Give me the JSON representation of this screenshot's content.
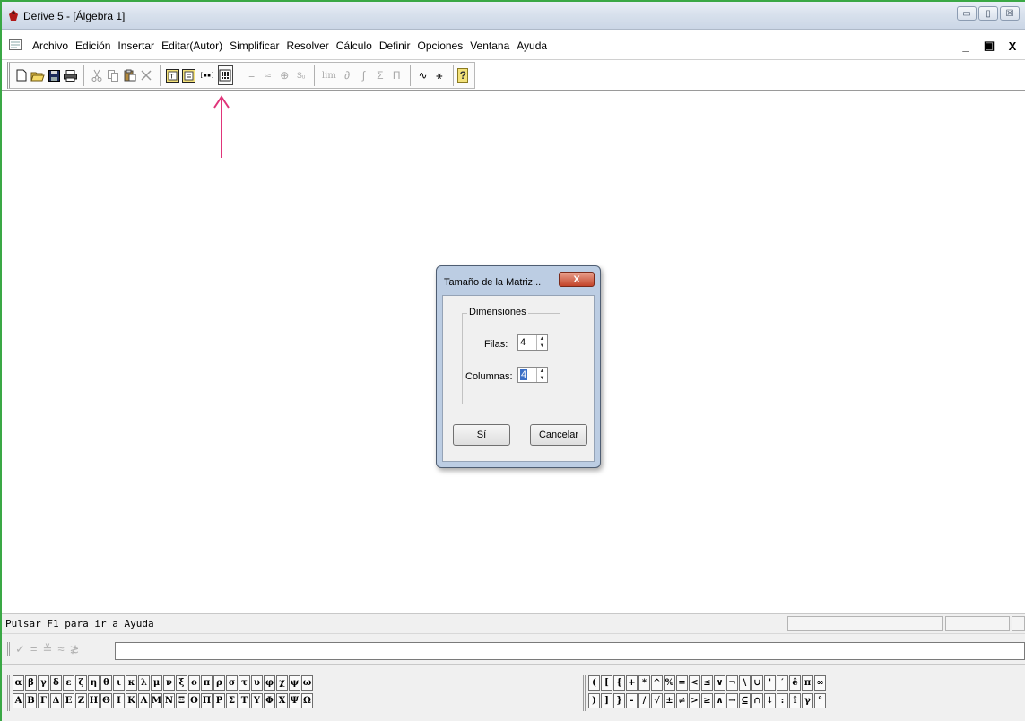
{
  "window": {
    "title": "Derive 5 - [Álgebra 1]",
    "sys_buttons": [
      "▭",
      "▯",
      "☒"
    ]
  },
  "menubar": {
    "items": [
      "Archivo",
      "Edición",
      "Insertar",
      "Editar(Autor)",
      "Simplificar",
      "Resolver",
      "Cálculo",
      "Definir",
      "Opciones",
      "Ventana",
      "Ayuda"
    ],
    "mdi_buttons": [
      "_",
      "▣",
      "X"
    ]
  },
  "toolbar": {
    "groups": [
      [
        "new-icon",
        "open-icon",
        "save-icon",
        "print-icon"
      ],
      [
        "cut-icon",
        "copy-icon",
        "paste-icon",
        "delete-icon"
      ],
      [
        "text-object-icon",
        "insert-object-icon",
        "vector-icon",
        "matrix-icon"
      ],
      [
        "equals-icon",
        "approximate-icon",
        "zoom-icon",
        "substitute-icon"
      ],
      [
        "limit-icon",
        "derivative-icon",
        "integral-icon",
        "sum-icon",
        "product-icon"
      ],
      [
        "2d-plot-icon",
        "3d-plot-icon"
      ],
      [
        "help-icon"
      ]
    ],
    "glyphs": {
      "vector_label": "[▪▪]",
      "equals": "=",
      "approx": "≈",
      "zoom": "⊕",
      "subst": "Sᵤ",
      "limit": "lim",
      "deriv": "∂",
      "integral": "∫",
      "sum": "Σ",
      "product": "Π",
      "plot2d": "∿",
      "plot3d": "⚹",
      "help": "?"
    }
  },
  "dialog": {
    "title": "Tamaño de la Matriz...",
    "close_label": "X",
    "group_label": "Dimensiones",
    "filas_label": "Filas:",
    "filas_value": "4",
    "columnas_label": "Columnas:",
    "columnas_value": "4",
    "ok_label": "Sí",
    "cancel_label": "Cancelar"
  },
  "status": {
    "text": "Pulsar F1 para ir a Ayuda"
  },
  "entry": {
    "buttons": [
      "✓",
      "=",
      "≚",
      "≈",
      "≵"
    ],
    "value": ""
  },
  "greek_palette": {
    "lower": [
      "α",
      "β",
      "γ",
      "δ",
      "ε",
      "ζ",
      "η",
      "θ",
      "ι",
      "κ",
      "λ",
      "μ",
      "ν",
      "ξ",
      "ο",
      "π",
      "ρ",
      "σ",
      "τ",
      "υ",
      "φ",
      "χ",
      "ψ",
      "ω"
    ],
    "upper": [
      "Α",
      "Β",
      "Γ",
      "Δ",
      "Ε",
      "Ζ",
      "Η",
      "Θ",
      "Ι",
      "Κ",
      "Λ",
      "Μ",
      "Ν",
      "Ξ",
      "Ο",
      "Π",
      "Ρ",
      "Σ",
      "Τ",
      "Υ",
      "Φ",
      "Χ",
      "Ψ",
      "Ω"
    ]
  },
  "math_palette": {
    "row1": [
      "(",
      "[",
      "{",
      "+",
      "*",
      "^",
      "%",
      "=",
      "<",
      "≤",
      "∨",
      "¬",
      "\\",
      "∪",
      "'",
      "′",
      "ê",
      "π",
      "∞"
    ],
    "row2": [
      ")",
      "]",
      "}",
      "-",
      "/",
      "√",
      "±",
      "≠",
      ">",
      "≥",
      "∧",
      "→",
      "⊆",
      "∩",
      "↓",
      ":",
      "î",
      "γ",
      "°"
    ]
  },
  "colors": {
    "accent_arrow": "#e0357a",
    "window_border": "#3aa845"
  }
}
